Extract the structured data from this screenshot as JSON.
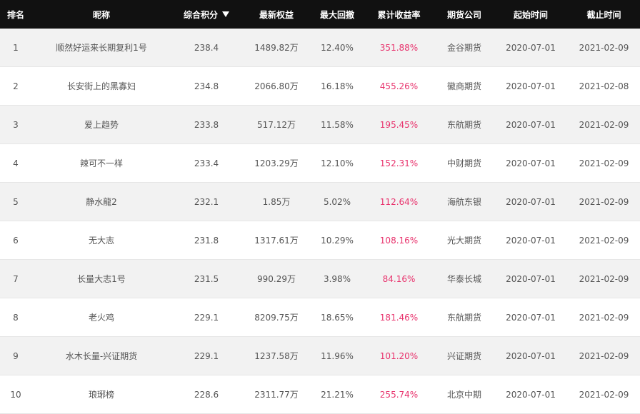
{
  "headers": {
    "rank": "排名",
    "nickname": "昵称",
    "score": "综合积分",
    "equity": "最新权益",
    "drawdown": "最大回撤",
    "return": "累计收益率",
    "broker": "期货公司",
    "start": "起始时间",
    "end": "截止时间"
  },
  "sort_icon": "sort-desc-icon",
  "colors": {
    "header_bg": "#111111",
    "return_text": "#e8336d",
    "row_alt": "#f2f2f2"
  },
  "rows": [
    {
      "rank": "1",
      "nickname": "顺然好运来长期复利1号",
      "score": "238.4",
      "equity": "1489.82万",
      "drawdown": "12.40%",
      "return": "351.88%",
      "broker": "金谷期货",
      "start": "2020-07-01",
      "end": "2021-02-09"
    },
    {
      "rank": "2",
      "nickname": "长安街上的黑寡妇",
      "score": "234.8",
      "equity": "2066.80万",
      "drawdown": "16.18%",
      "return": "455.26%",
      "broker": "徽商期货",
      "start": "2020-07-01",
      "end": "2021-02-08"
    },
    {
      "rank": "3",
      "nickname": "爱上趋势",
      "score": "233.8",
      "equity": "517.12万",
      "drawdown": "11.58%",
      "return": "195.45%",
      "broker": "东航期货",
      "start": "2020-07-01",
      "end": "2021-02-09"
    },
    {
      "rank": "4",
      "nickname": "辣可不一样",
      "score": "233.4",
      "equity": "1203.29万",
      "drawdown": "12.10%",
      "return": "152.31%",
      "broker": "中财期货",
      "start": "2020-07-01",
      "end": "2021-02-09"
    },
    {
      "rank": "5",
      "nickname": "静水龍2",
      "score": "232.1",
      "equity": "1.85万",
      "drawdown": "5.02%",
      "return": "112.64%",
      "broker": "海航东银",
      "start": "2020-07-01",
      "end": "2021-02-09"
    },
    {
      "rank": "6",
      "nickname": "无大志",
      "score": "231.8",
      "equity": "1317.61万",
      "drawdown": "10.29%",
      "return": "108.16%",
      "broker": "光大期货",
      "start": "2020-07-01",
      "end": "2021-02-09"
    },
    {
      "rank": "7",
      "nickname": "长量大志1号",
      "score": "231.5",
      "equity": "990.29万",
      "drawdown": "3.98%",
      "return": "84.16%",
      "broker": "华泰长城",
      "start": "2020-07-01",
      "end": "2021-02-09"
    },
    {
      "rank": "8",
      "nickname": "老火鸡",
      "score": "229.1",
      "equity": "8209.75万",
      "drawdown": "18.65%",
      "return": "181.46%",
      "broker": "东航期货",
      "start": "2020-07-01",
      "end": "2021-02-09"
    },
    {
      "rank": "9",
      "nickname": "水木长量-兴证期货",
      "score": "229.1",
      "equity": "1237.58万",
      "drawdown": "11.96%",
      "return": "101.20%",
      "broker": "兴证期货",
      "start": "2020-07-01",
      "end": "2021-02-09"
    },
    {
      "rank": "10",
      "nickname": "琅琊榜",
      "score": "228.6",
      "equity": "2311.77万",
      "drawdown": "21.21%",
      "return": "255.74%",
      "broker": "北京中期",
      "start": "2020-07-01",
      "end": "2021-02-09"
    }
  ]
}
